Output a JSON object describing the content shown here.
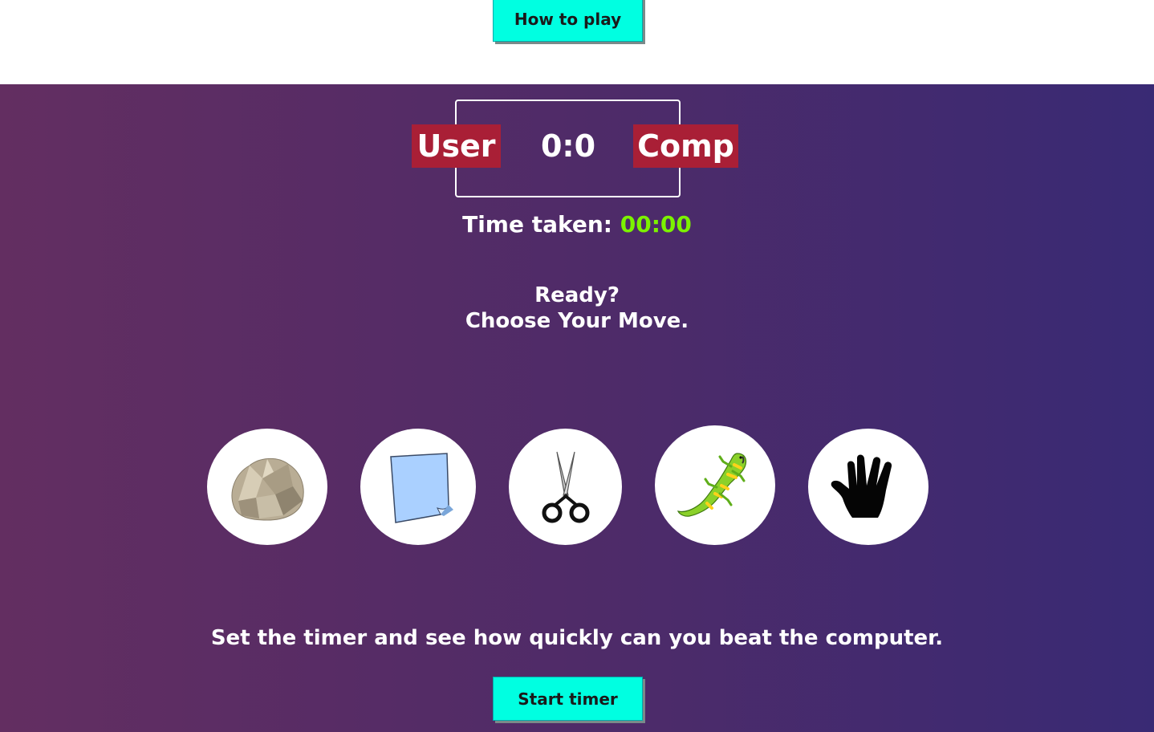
{
  "header": {
    "how_to_play_label": "How to play"
  },
  "scoreboard": {
    "user_label": "User",
    "comp_label": "Comp",
    "score": "0:0"
  },
  "timer": {
    "label": "Time taken:",
    "value": "00:00"
  },
  "message": {
    "line1": "Ready?",
    "line2": "Choose Your Move."
  },
  "choices": [
    {
      "name": "rock",
      "icon": "rock-icon"
    },
    {
      "name": "paper",
      "icon": "paper-icon"
    },
    {
      "name": "scissors",
      "icon": "scissors-icon"
    },
    {
      "name": "lizard",
      "icon": "lizard-icon"
    },
    {
      "name": "spock",
      "icon": "spock-hand-icon"
    }
  ],
  "footer": {
    "prompt": "Set the timer and see how quickly can you beat the computer.",
    "start_timer_label": "Start timer"
  },
  "colors": {
    "accent_button": "#00ffe1",
    "badge": "#a91f36",
    "timer_value": "#7cf200",
    "gradient_start": "#632e61",
    "gradient_end": "#392a74"
  }
}
